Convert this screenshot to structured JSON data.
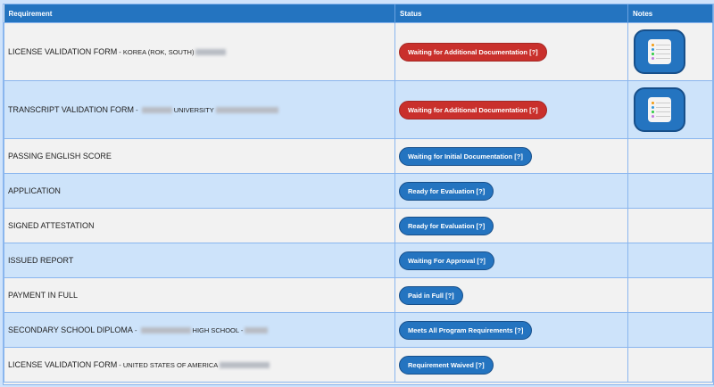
{
  "headers": {
    "requirement": "Requirement",
    "status": "Status",
    "notes": "Notes"
  },
  "rows": [
    {
      "title": "LICENSE VALIDATION FORM",
      "sep": " - ",
      "detail": "KOREA (ROK, SOUTH)",
      "status": "Waiting for Additional Documentation [?]",
      "status_color": "#c9302c"
    },
    {
      "title": "TRANSCRIPT VALIDATION FORM",
      "sep": " - ",
      "detail": "UNIVERSITY",
      "status": "Waiting for Additional Documentation [?]",
      "status_color": "#c9302c"
    },
    {
      "title": "PASSING ENGLISH SCORE",
      "status": "Waiting for Initial Documentation [?]"
    },
    {
      "title": "APPLICATION",
      "status": "Ready for Evaluation [?]"
    },
    {
      "title": "SIGNED ATTESTATION",
      "status": "Ready for Evaluation [?]"
    },
    {
      "title": "ISSUED REPORT",
      "status": "Waiting For Approval [?]"
    },
    {
      "title": "PAYMENT IN FULL",
      "status": "Paid in Full [?]"
    },
    {
      "title": "SECONDARY SCHOOL DIPLOMA",
      "sep": " - ",
      "detail": "HIGH SCHOOL -",
      "status": "Meets All Program Requirements [?]"
    },
    {
      "title": "LICENSE VALIDATION FORM",
      "sep": " - ",
      "detail": "UNITED STATES OF AMERICA",
      "status": "Requirement Waived [?]"
    }
  ],
  "colors": {
    "header": "#2474c0",
    "badge_blue": "#2474c0",
    "badge_red": "#c9302c"
  }
}
